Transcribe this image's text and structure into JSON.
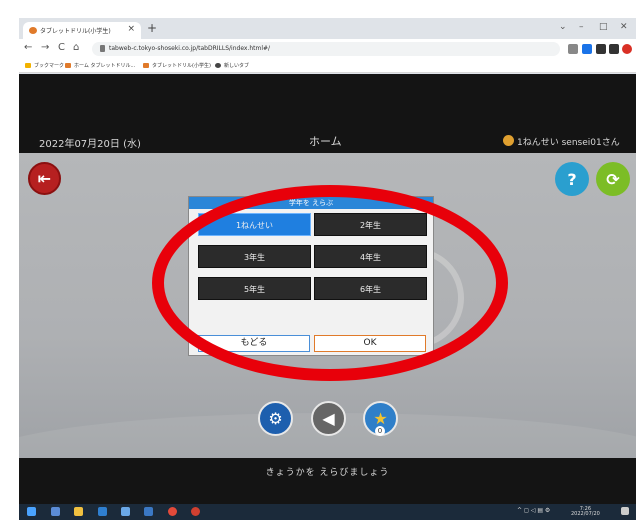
{
  "browser": {
    "tab_title": "タブレットドリル(小学生)",
    "tab_close": "×",
    "new_tab": "+",
    "controls": [
      "⌄",
      "–",
      "□",
      "✕"
    ],
    "nav": {
      "back": "←",
      "forward": "→",
      "reload": "C",
      "home": "⌂"
    },
    "url": "tabweb-c.tokyo-shoseki.co.jp/tabDRILLS/index.html#/",
    "bookmarks": [
      "ブックマーク",
      "ホーム タブレットドリル...",
      "タブレットドリル(小学生)",
      "新しいタブ"
    ]
  },
  "app": {
    "date": "2022年07月20日 (水)",
    "title": "ホーム",
    "user": "1ねんせい sensei01さん",
    "help_label": "?",
    "footer_message": "きょうかを えらびましょう",
    "star_count": "0"
  },
  "dialog": {
    "title": "学年を えらぶ",
    "grades": [
      {
        "label": "1ねんせい",
        "selected": true
      },
      {
        "label": "2年生",
        "selected": false
      },
      {
        "label": "3年生",
        "selected": false
      },
      {
        "label": "4年生",
        "selected": false
      },
      {
        "label": "5年生",
        "selected": false
      },
      {
        "label": "6年生",
        "selected": false
      }
    ],
    "back_label": "もどる",
    "ok_label": "OK"
  },
  "taskbar": {
    "tray_time": "7:26",
    "tray_date": "2022/07/20"
  },
  "colors": {
    "annotation": "#e8000a",
    "dialog_header": "#2a86d8",
    "selected_grade": "#1f7fe0",
    "exit_button": "#b62020",
    "help_button": "#2a9fcf",
    "reload_button": "#7cbd26"
  }
}
